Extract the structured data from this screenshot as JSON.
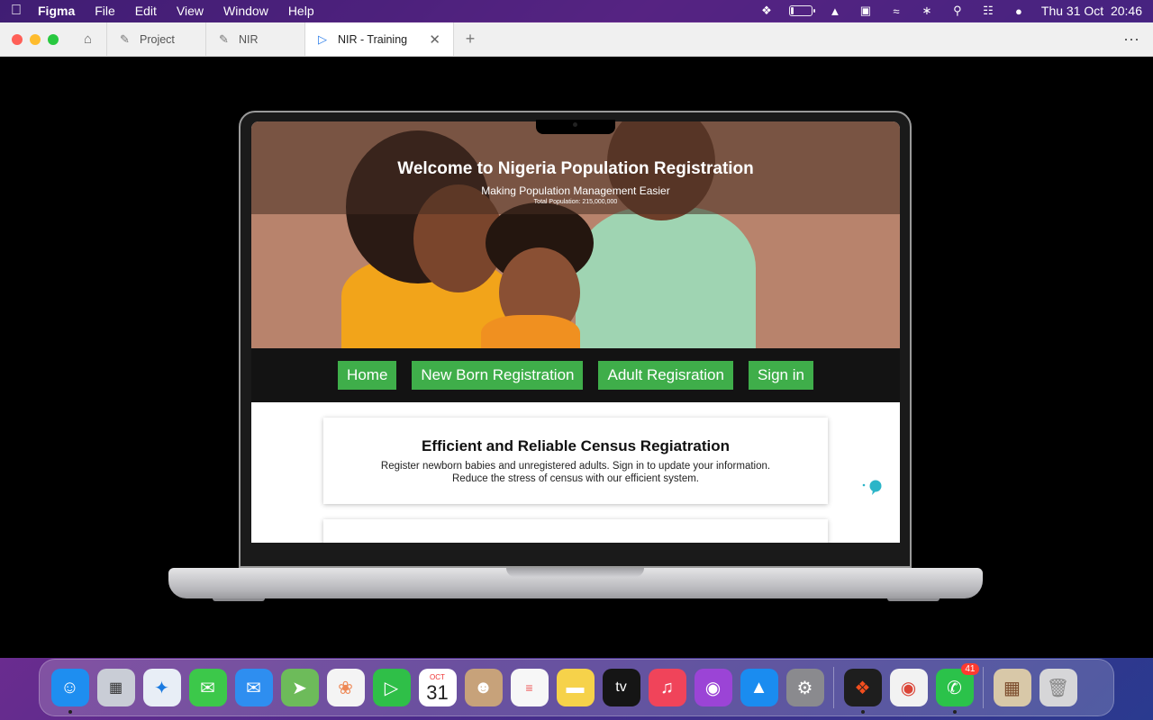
{
  "menubar": {
    "app_name": "Figma",
    "menus": [
      "File",
      "Edit",
      "View",
      "Window",
      "Help"
    ],
    "datetime": "Thu 31 Oct  20:46"
  },
  "tabs": {
    "items": [
      {
        "label": "Project",
        "icon": "figma-file-icon"
      },
      {
        "label": "NIR",
        "icon": "figma-file-icon"
      },
      {
        "label": "NIR - Training",
        "icon": "play-prototype-icon",
        "active": true
      }
    ]
  },
  "site": {
    "hero": {
      "title": "Welcome to Nigeria Population Registration",
      "subtitle": "Making Population Management Easier",
      "population": "Total Population: 215,000,000"
    },
    "nav": {
      "home": "Home",
      "newborn": "New Born Registration",
      "adult": "Adult Regisration",
      "signin": "Sign in"
    },
    "card": {
      "heading": "Efficient and Reliable Census Regiatration",
      "line1": "Register newborn babies and unregistered adults. Sign in to update your information.",
      "line2": "Reduce the stress of census with our efficient system."
    }
  },
  "dock": {
    "apps": [
      {
        "name": "Finder",
        "color": "#1e8ef0",
        "running": true
      },
      {
        "name": "Launchpad",
        "color": "#c9cdd6"
      },
      {
        "name": "Safari",
        "color": "#e8eef6"
      },
      {
        "name": "Messages",
        "color": "#3cc84a"
      },
      {
        "name": "Mail",
        "color": "#2e8ef0"
      },
      {
        "name": "Maps",
        "color": "#6dbb5a"
      },
      {
        "name": "Photos",
        "color": "#f4f4f4"
      },
      {
        "name": "FaceTime",
        "color": "#2fbf48"
      },
      {
        "name": "Calendar",
        "month": "OCT",
        "day": "31"
      },
      {
        "name": "Contacts",
        "color": "#c7a27a"
      },
      {
        "name": "Reminders",
        "color": "#f7f7f7"
      },
      {
        "name": "Notes",
        "color": "#f6d24a"
      },
      {
        "name": "Apple TV",
        "color": "#151515",
        "label": "tv"
      },
      {
        "name": "Music",
        "color": "#f0445a"
      },
      {
        "name": "Podcasts",
        "color": "#9b44d6"
      },
      {
        "name": "App Store",
        "color": "#1a8cf0"
      },
      {
        "name": "System Settings",
        "color": "#8a8a8e"
      }
    ],
    "running_apps": [
      {
        "name": "Figma",
        "color": "#1e1e1e",
        "running": true
      },
      {
        "name": "Chrome",
        "color": "#f2f2f2"
      },
      {
        "name": "WhatsApp",
        "color": "#2bc24a",
        "running": true,
        "badge": "41"
      }
    ],
    "extras": [
      {
        "name": "Downloads stack",
        "color": "#d8c8a8"
      },
      {
        "name": "Trash",
        "color": "#d6d6d8"
      }
    ]
  }
}
